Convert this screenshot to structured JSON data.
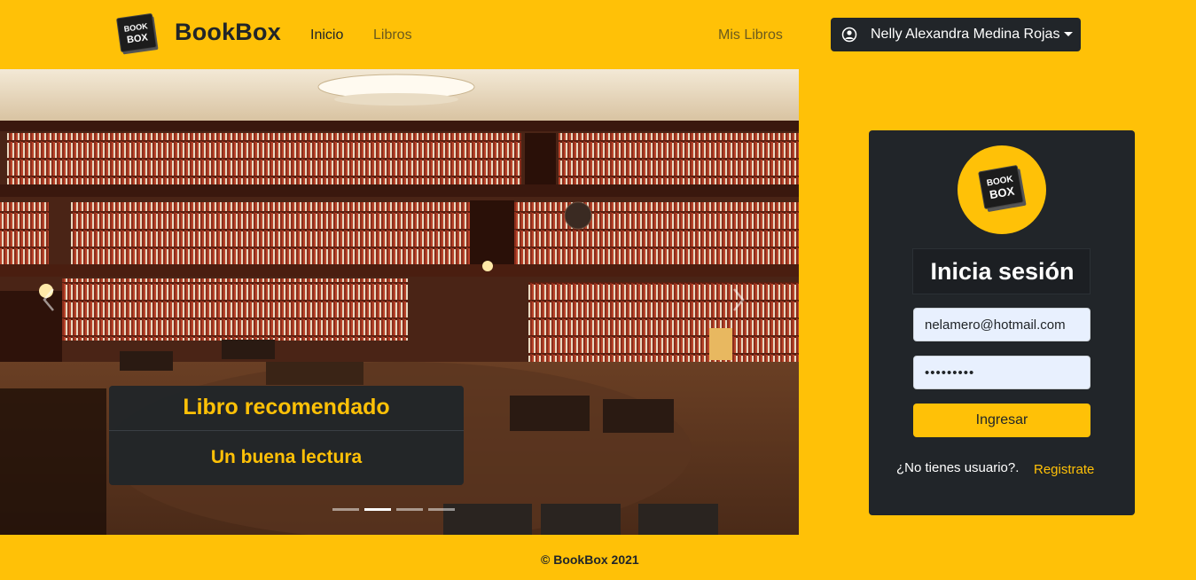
{
  "colors": {
    "accent": "#ffc107",
    "dark": "#212529"
  },
  "navbar": {
    "brand_logo_text_top": "BOOK",
    "brand_logo_text_bottom": "BOX",
    "brand_name": "BookBox",
    "links": {
      "inicio": "Inicio",
      "libros": "Libros",
      "mis_libros": "Mis Libros"
    },
    "user_icon": "user-circle-icon",
    "user_name": "Nelly Alexandra Medina Rojas"
  },
  "carousel": {
    "prev_icon": "chevron-left-icon",
    "next_icon": "chevron-right-icon",
    "caption_title": "Libro recomendado",
    "caption_subtitle": "Un buena lectura",
    "indicators": 4,
    "active_indicator": 2
  },
  "login": {
    "logo_text_top": "BOOK",
    "logo_text_bottom": "BOX",
    "title": "Inicia sesión",
    "email_value": "nelamero@hotmail.com",
    "password_value": "•••••••••",
    "submit_label": "Ingresar",
    "no_user_text": "¿No tienes usuario?.",
    "register_label": "Registrate"
  },
  "footer": {
    "text": "© BookBox 2021"
  }
}
